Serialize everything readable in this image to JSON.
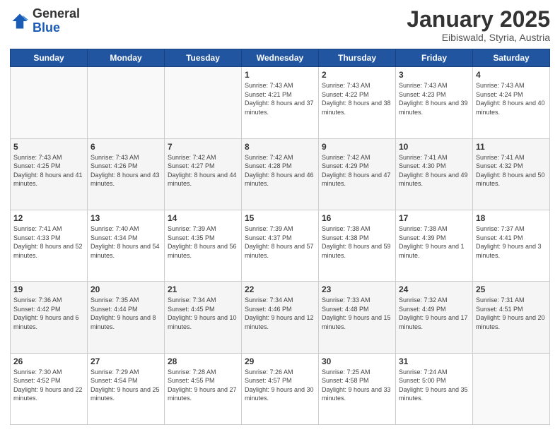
{
  "header": {
    "logo_general": "General",
    "logo_blue": "Blue",
    "title": "January 2025",
    "subtitle": "Eibiswald, Styria, Austria"
  },
  "days_of_week": [
    "Sunday",
    "Monday",
    "Tuesday",
    "Wednesday",
    "Thursday",
    "Friday",
    "Saturday"
  ],
  "weeks": [
    [
      {
        "day": "",
        "info": ""
      },
      {
        "day": "",
        "info": ""
      },
      {
        "day": "",
        "info": ""
      },
      {
        "day": "1",
        "info": "Sunrise: 7:43 AM\nSunset: 4:21 PM\nDaylight: 8 hours and 37 minutes."
      },
      {
        "day": "2",
        "info": "Sunrise: 7:43 AM\nSunset: 4:22 PM\nDaylight: 8 hours and 38 minutes."
      },
      {
        "day": "3",
        "info": "Sunrise: 7:43 AM\nSunset: 4:23 PM\nDaylight: 8 hours and 39 minutes."
      },
      {
        "day": "4",
        "info": "Sunrise: 7:43 AM\nSunset: 4:24 PM\nDaylight: 8 hours and 40 minutes."
      }
    ],
    [
      {
        "day": "5",
        "info": "Sunrise: 7:43 AM\nSunset: 4:25 PM\nDaylight: 8 hours and 41 minutes."
      },
      {
        "day": "6",
        "info": "Sunrise: 7:43 AM\nSunset: 4:26 PM\nDaylight: 8 hours and 43 minutes."
      },
      {
        "day": "7",
        "info": "Sunrise: 7:42 AM\nSunset: 4:27 PM\nDaylight: 8 hours and 44 minutes."
      },
      {
        "day": "8",
        "info": "Sunrise: 7:42 AM\nSunset: 4:28 PM\nDaylight: 8 hours and 46 minutes."
      },
      {
        "day": "9",
        "info": "Sunrise: 7:42 AM\nSunset: 4:29 PM\nDaylight: 8 hours and 47 minutes."
      },
      {
        "day": "10",
        "info": "Sunrise: 7:41 AM\nSunset: 4:30 PM\nDaylight: 8 hours and 49 minutes."
      },
      {
        "day": "11",
        "info": "Sunrise: 7:41 AM\nSunset: 4:32 PM\nDaylight: 8 hours and 50 minutes."
      }
    ],
    [
      {
        "day": "12",
        "info": "Sunrise: 7:41 AM\nSunset: 4:33 PM\nDaylight: 8 hours and 52 minutes."
      },
      {
        "day": "13",
        "info": "Sunrise: 7:40 AM\nSunset: 4:34 PM\nDaylight: 8 hours and 54 minutes."
      },
      {
        "day": "14",
        "info": "Sunrise: 7:39 AM\nSunset: 4:35 PM\nDaylight: 8 hours and 56 minutes."
      },
      {
        "day": "15",
        "info": "Sunrise: 7:39 AM\nSunset: 4:37 PM\nDaylight: 8 hours and 57 minutes."
      },
      {
        "day": "16",
        "info": "Sunrise: 7:38 AM\nSunset: 4:38 PM\nDaylight: 8 hours and 59 minutes."
      },
      {
        "day": "17",
        "info": "Sunrise: 7:38 AM\nSunset: 4:39 PM\nDaylight: 9 hours and 1 minute."
      },
      {
        "day": "18",
        "info": "Sunrise: 7:37 AM\nSunset: 4:41 PM\nDaylight: 9 hours and 3 minutes."
      }
    ],
    [
      {
        "day": "19",
        "info": "Sunrise: 7:36 AM\nSunset: 4:42 PM\nDaylight: 9 hours and 6 minutes."
      },
      {
        "day": "20",
        "info": "Sunrise: 7:35 AM\nSunset: 4:44 PM\nDaylight: 9 hours and 8 minutes."
      },
      {
        "day": "21",
        "info": "Sunrise: 7:34 AM\nSunset: 4:45 PM\nDaylight: 9 hours and 10 minutes."
      },
      {
        "day": "22",
        "info": "Sunrise: 7:34 AM\nSunset: 4:46 PM\nDaylight: 9 hours and 12 minutes."
      },
      {
        "day": "23",
        "info": "Sunrise: 7:33 AM\nSunset: 4:48 PM\nDaylight: 9 hours and 15 minutes."
      },
      {
        "day": "24",
        "info": "Sunrise: 7:32 AM\nSunset: 4:49 PM\nDaylight: 9 hours and 17 minutes."
      },
      {
        "day": "25",
        "info": "Sunrise: 7:31 AM\nSunset: 4:51 PM\nDaylight: 9 hours and 20 minutes."
      }
    ],
    [
      {
        "day": "26",
        "info": "Sunrise: 7:30 AM\nSunset: 4:52 PM\nDaylight: 9 hours and 22 minutes."
      },
      {
        "day": "27",
        "info": "Sunrise: 7:29 AM\nSunset: 4:54 PM\nDaylight: 9 hours and 25 minutes."
      },
      {
        "day": "28",
        "info": "Sunrise: 7:28 AM\nSunset: 4:55 PM\nDaylight: 9 hours and 27 minutes."
      },
      {
        "day": "29",
        "info": "Sunrise: 7:26 AM\nSunset: 4:57 PM\nDaylight: 9 hours and 30 minutes."
      },
      {
        "day": "30",
        "info": "Sunrise: 7:25 AM\nSunset: 4:58 PM\nDaylight: 9 hours and 33 minutes."
      },
      {
        "day": "31",
        "info": "Sunrise: 7:24 AM\nSunset: 5:00 PM\nDaylight: 9 hours and 35 minutes."
      },
      {
        "day": "",
        "info": ""
      }
    ]
  ]
}
